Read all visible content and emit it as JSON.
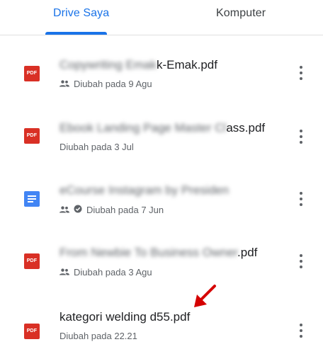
{
  "tabs": [
    {
      "label": "Drive Saya",
      "active": true
    },
    {
      "label": "Komputer",
      "active": false
    }
  ],
  "colors": {
    "accent": "#1a73e8",
    "pdf": "#d93025",
    "doc": "#4285f4",
    "annotation_arrow": "#d50000"
  },
  "files": [
    {
      "type": "pdf",
      "name_blurred": "Copywriting Emak",
      "name_visible": "k-Emak.pdf",
      "shared": true,
      "meta": "Diubah pada 9 Agu"
    },
    {
      "type": "pdf",
      "name_blurred": "Ebook Landing Page Master Cl",
      "name_visible": "ass.pdf",
      "shared": false,
      "meta": "Diubah pada 3 Jul"
    },
    {
      "type": "doc",
      "name_blurred": "eCourse Instagram by Presiden",
      "name_visible": "",
      "shared": true,
      "verified": true,
      "meta": "Diubah pada 7 Jun"
    },
    {
      "type": "pdf",
      "name_blurred": "From Newbie To Business Owner",
      "name_visible": ".pdf",
      "shared": true,
      "meta": "Diubah pada 3 Agu"
    },
    {
      "type": "pdf",
      "name_blurred": "",
      "name_visible": "kategori welding d55.pdf",
      "shared": false,
      "meta": "Diubah pada 22.21"
    }
  ],
  "icons": {
    "file_pdf_label": "PDF",
    "people": "people-icon",
    "verified": "check-circle-icon",
    "more": "more-vert-icon"
  }
}
